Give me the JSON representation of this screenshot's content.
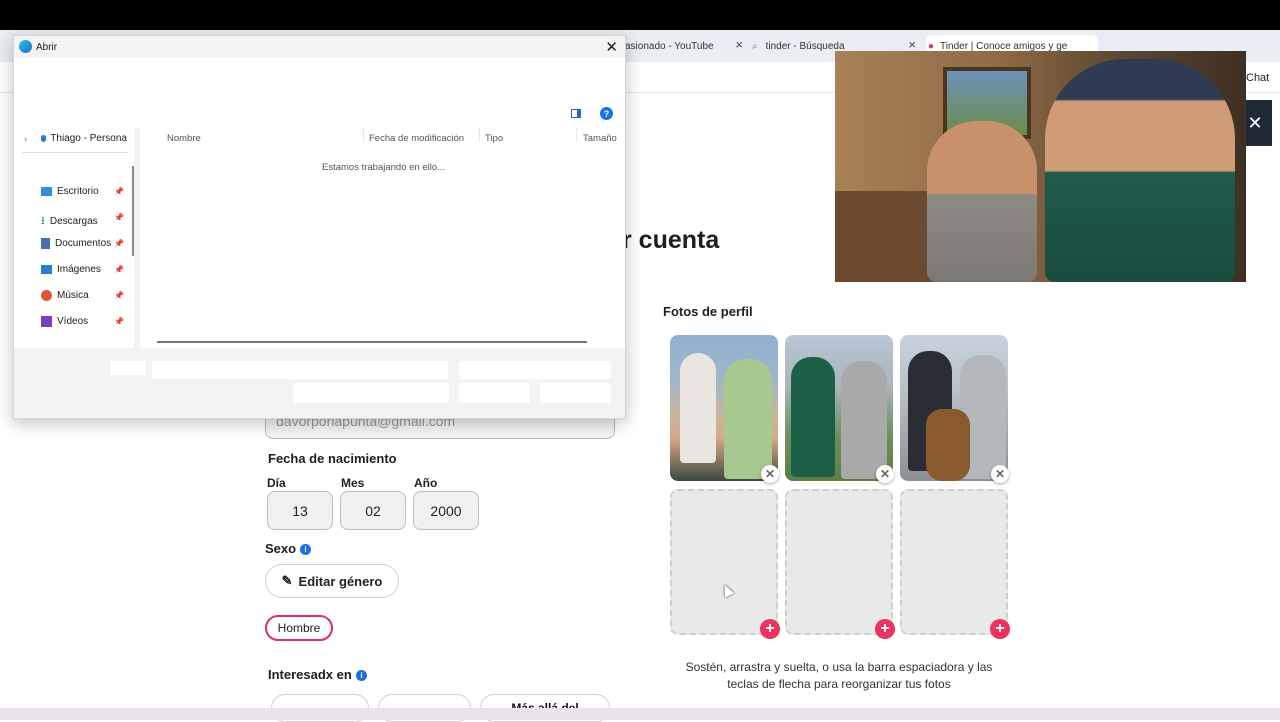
{
  "browser": {
    "tabs": [
      {
        "label": "asionado - YouTube"
      },
      {
        "label": "tinder - Búsqueda"
      },
      {
        "label": "Tinder | Conoce amigos y ge"
      }
    ],
    "chat_label": "Chat"
  },
  "page": {
    "heading_fragment": "r cuenta",
    "email_value": "davorporlapunta@gmail.com",
    "birthdate": {
      "label": "Fecha de nacimiento",
      "day_label": "Día",
      "day_value": "13",
      "month_label": "Mes",
      "month_value": "02",
      "year_label": "Año",
      "year_value": "2000"
    },
    "sex": {
      "label": "Sexo",
      "edit_button": "Editar género",
      "selected_value": "Hombre"
    },
    "interested": {
      "label": "Interesadx en",
      "option_3": "Más allá del"
    },
    "photos": {
      "title": "Fotos de perfil",
      "help": "Sostén, arrastra y suelta, o usa la barra espaciadora y las teclas de flecha para reorganizar tus fotos",
      "filled_count": 3,
      "total_slots": 6
    }
  },
  "dialog": {
    "title": "Abrir",
    "nav_root": "Thiago - Persona",
    "nav_items": [
      {
        "label": "Escritorio",
        "icon": "desktop-icon",
        "color": "#2f8fe0"
      },
      {
        "label": "Descargas",
        "icon": "download-icon",
        "color": "#1f9d55"
      },
      {
        "label": "Documentos",
        "icon": "document-icon",
        "color": "#4a6fb5"
      },
      {
        "label": "Imágenes",
        "icon": "image-icon",
        "color": "#2a7fd4"
      },
      {
        "label": "Música",
        "icon": "music-icon",
        "color": "#e0533a"
      },
      {
        "label": "Vídeos",
        "icon": "video-icon",
        "color": "#7b3fc4"
      }
    ],
    "columns": [
      "Nombre",
      "Fecha de modificación",
      "Tipo",
      "Tamaño"
    ],
    "status": "Estamos trabajando en ello..."
  },
  "colors": {
    "accent": "#e8345f",
    "info": "#1a6ee8"
  }
}
